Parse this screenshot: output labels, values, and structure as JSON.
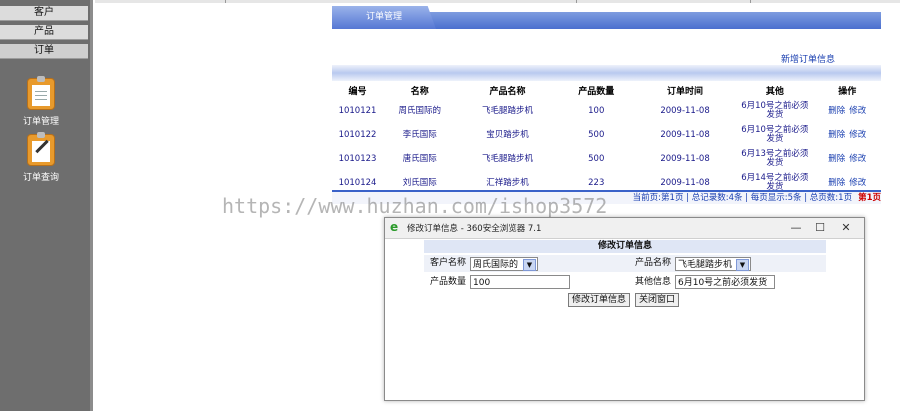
{
  "sidebar": {
    "tabs": [
      {
        "label": "客户"
      },
      {
        "label": "产品"
      },
      {
        "label": "订单"
      }
    ],
    "items": [
      {
        "label": "订单管理",
        "icon": "clipboard-icon"
      },
      {
        "label": "订单查询",
        "icon": "clipboard-pen-icon"
      }
    ]
  },
  "header": {
    "tab_label": "订单管理"
  },
  "add_link": "新增订单信息",
  "table": {
    "columns": [
      "编号",
      "名称",
      "产品名称",
      "产品数量",
      "订单时间",
      "其他",
      "操作"
    ],
    "rows": [
      {
        "id": "1010121",
        "name": "周氏国际的",
        "product": "飞毛腿踏步机",
        "qty": "100",
        "time": "2009-11-08",
        "other": "6月10号之前必须发货",
        "del": "删除",
        "edit": "修改"
      },
      {
        "id": "1010122",
        "name": "李氏国际",
        "product": "宝贝踏步机",
        "qty": "500",
        "time": "2009-11-08",
        "other": "6月10号之前必须发货",
        "del": "删除",
        "edit": "修改"
      },
      {
        "id": "1010123",
        "name": "唐氏国际",
        "product": "飞毛腿踏步机",
        "qty": "500",
        "time": "2009-11-08",
        "other": "6月13号之前必须发货",
        "del": "删除",
        "edit": "修改"
      },
      {
        "id": "1010124",
        "name": "刘氏国际",
        "product": "汇祥踏步机",
        "qty": "223",
        "time": "2009-11-08",
        "other": "6月14号之前必须发货",
        "del": "删除",
        "edit": "修改"
      }
    ]
  },
  "pagination": {
    "text": "当前页:第1页 | 总记录数:4条 | 每页显示:5条 | 总页数:1页",
    "current": "第1页"
  },
  "watermark": "https://www.huzhan.com/ishop3572",
  "dialog": {
    "window_title": "修改订单信息 - 360安全浏览器 7.1",
    "form_title": "修改订单信息",
    "customer_label": "客户名称",
    "customer_value": "周氏国际的",
    "product_label": "产品名称",
    "product_value": "飞毛腿踏步机",
    "qty_label": "产品数量",
    "qty_value": "100",
    "other_label": "其他信息",
    "other_value": "6月10号之前必须发货",
    "submit_label": "修改订单信息",
    "close_label": "关闭窗口"
  },
  "colors": {
    "accent": "#4a6fcf",
    "sidebar": "#6e6e6e",
    "link": "#1a3fb0",
    "current_page": "#cc0000"
  }
}
